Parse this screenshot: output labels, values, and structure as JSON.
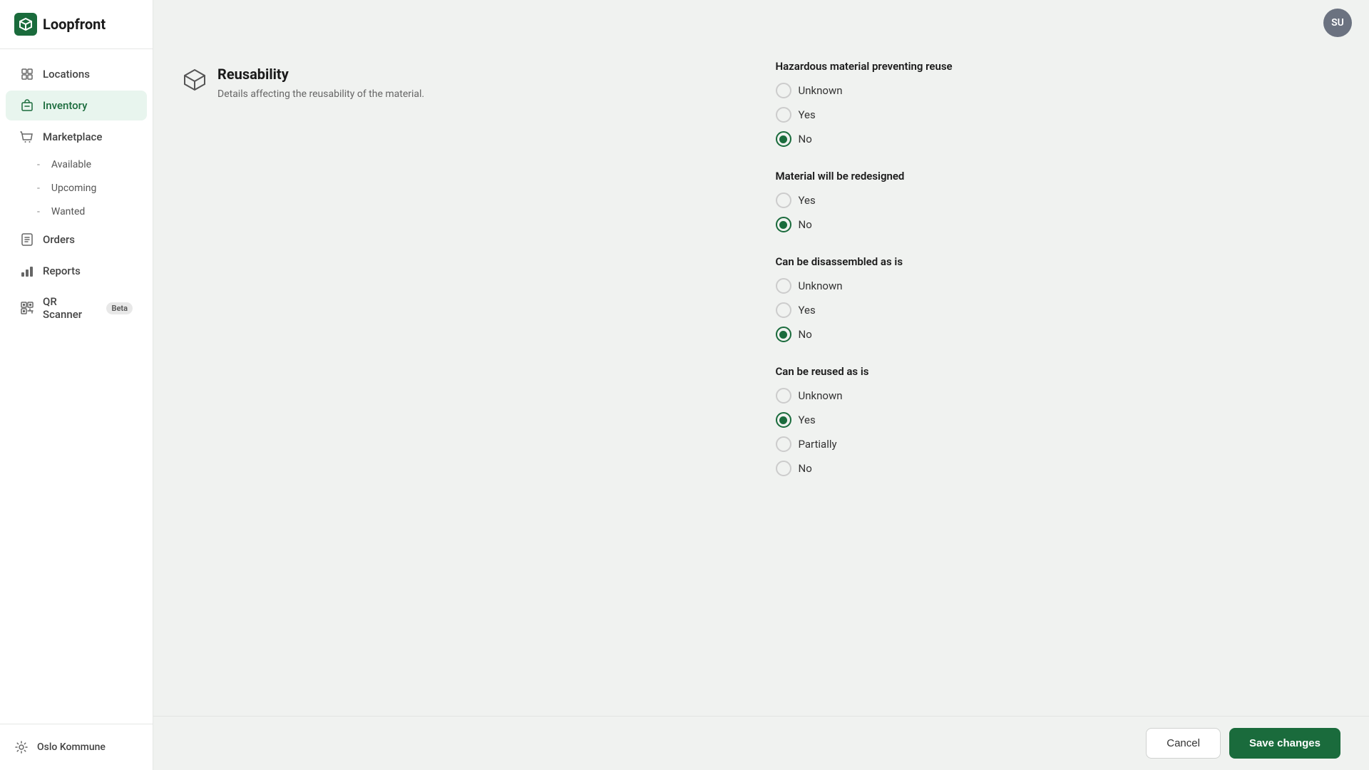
{
  "app": {
    "name": "Loopfront",
    "trademark": "™"
  },
  "user": {
    "initials": "SU"
  },
  "sidebar": {
    "items": [
      {
        "id": "locations",
        "label": "Locations",
        "icon": "location-icon"
      },
      {
        "id": "inventory",
        "label": "Inventory",
        "icon": "inventory-icon",
        "active": true
      },
      {
        "id": "marketplace",
        "label": "Marketplace",
        "icon": "marketplace-icon"
      }
    ],
    "sub_items": [
      {
        "id": "available",
        "label": "Available"
      },
      {
        "id": "upcoming",
        "label": "Upcoming"
      },
      {
        "id": "wanted",
        "label": "Wanted"
      }
    ],
    "bottom_items": [
      {
        "id": "orders",
        "label": "Orders",
        "icon": "orders-icon"
      },
      {
        "id": "reports",
        "label": "Reports",
        "icon": "reports-icon"
      },
      {
        "id": "qr-scanner",
        "label": "QR Scanner",
        "icon": "qr-icon",
        "badge": "Beta"
      }
    ],
    "org": {
      "label": "Oslo Kommune",
      "icon": "settings-icon"
    }
  },
  "section": {
    "title": "Reusability",
    "description": "Details affecting the reusability of the material."
  },
  "form_groups": [
    {
      "id": "hazardous",
      "label": "Hazardous material preventing reuse",
      "options": [
        {
          "value": "unknown",
          "label": "Unknown",
          "checked": false
        },
        {
          "value": "yes",
          "label": "Yes",
          "checked": false
        },
        {
          "value": "no",
          "label": "No",
          "checked": true
        }
      ]
    },
    {
      "id": "redesigned",
      "label": "Material will be redesigned",
      "options": [
        {
          "value": "yes",
          "label": "Yes",
          "checked": false
        },
        {
          "value": "no",
          "label": "No",
          "checked": true
        }
      ]
    },
    {
      "id": "disassembled",
      "label": "Can be disassembled as is",
      "options": [
        {
          "value": "unknown",
          "label": "Unknown",
          "checked": false
        },
        {
          "value": "yes",
          "label": "Yes",
          "checked": false
        },
        {
          "value": "no",
          "label": "No",
          "checked": true
        }
      ]
    },
    {
      "id": "reused",
      "label": "Can be reused as is",
      "options": [
        {
          "value": "unknown",
          "label": "Unknown",
          "checked": false
        },
        {
          "value": "yes",
          "label": "Yes",
          "checked": true
        },
        {
          "value": "partially",
          "label": "Partially",
          "checked": false
        },
        {
          "value": "no",
          "label": "No",
          "checked": false
        }
      ]
    }
  ],
  "buttons": {
    "cancel": "Cancel",
    "save": "Save changes"
  }
}
